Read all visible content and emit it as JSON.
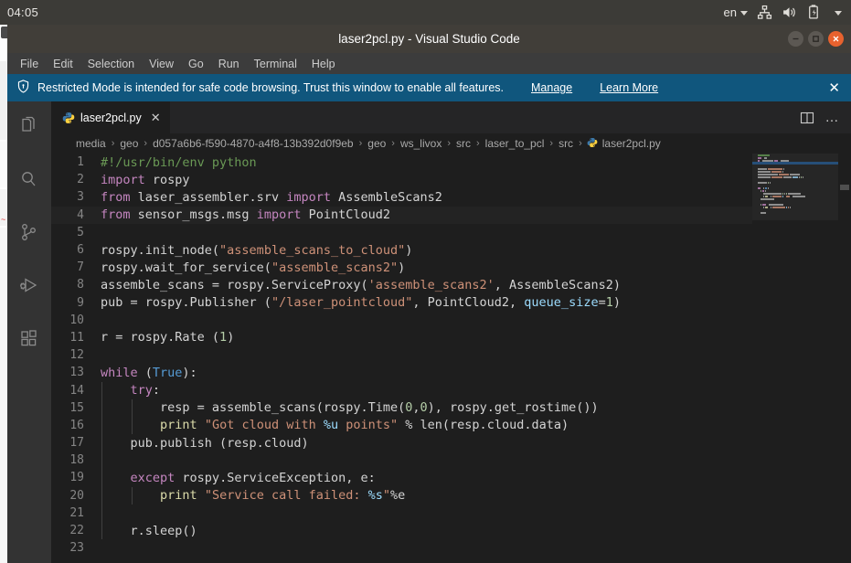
{
  "os_panel": {
    "clock": "04:05",
    "language_indicator": "en",
    "tray_icons": [
      "network-icon",
      "volume-icon",
      "battery-icon",
      "system-menu-caret-icon"
    ]
  },
  "window": {
    "title": "laser2pcl.py - Visual Studio Code",
    "controls": {
      "minimize_label": "–",
      "maximize_label": "□",
      "close_label": "✕"
    }
  },
  "menubar": {
    "items": [
      {
        "label": "File"
      },
      {
        "label": "Edit"
      },
      {
        "label": "Selection"
      },
      {
        "label": "View"
      },
      {
        "label": "Go"
      },
      {
        "label": "Run"
      },
      {
        "label": "Terminal"
      },
      {
        "label": "Help"
      }
    ]
  },
  "banner": {
    "icon": "shield-icon",
    "message": "Restricted Mode is intended for safe code browsing. Trust this window to enable all features.",
    "manage_label": "Manage",
    "learn_more_label": "Learn More",
    "close_label": "✕",
    "background": "#10567d"
  },
  "activity_bar": {
    "items": [
      {
        "name": "explorer-icon",
        "label": "Explorer"
      },
      {
        "name": "search-icon",
        "label": "Search"
      },
      {
        "name": "source-control-icon",
        "label": "Source Control"
      },
      {
        "name": "run-and-debug-icon",
        "label": "Run and Debug"
      },
      {
        "name": "extensions-icon",
        "label": "Extensions"
      }
    ]
  },
  "tabs": {
    "active": {
      "label": "laser2pcl.py",
      "icon": "python-file-icon",
      "close_label": "✕"
    },
    "actions": [
      {
        "name": "split-editor-icon",
        "label": "Split Editor"
      },
      {
        "name": "more-actions-icon",
        "label": "…"
      }
    ]
  },
  "breadcrumbs": {
    "separator": "›",
    "items": [
      "media",
      "geo",
      "d057a6b6-f590-4870-a4f8-13b392d0f9eb",
      "geo",
      "ws_livox",
      "src",
      "laser_to_pcl",
      "src"
    ],
    "file": "laser2pcl.py",
    "file_icon": "python-file-icon"
  },
  "editor": {
    "language": "python",
    "theme": "Dark+",
    "first_line": 1,
    "last_line": 23,
    "highlighted_line": 4,
    "colors": {
      "background": "#1e1e1e",
      "foreground": "#d4d4d4",
      "line_number": "#858585",
      "comment": "#6a9955",
      "keyword": "#c586c0",
      "builtin_keyword": "#569cd6",
      "string": "#ce9178",
      "function": "#dcdcaa",
      "variable": "#9cdcfe",
      "number": "#b5cea8",
      "class": "#4ec9b0",
      "current_line_bg": "#232323",
      "indent_guide": "#404040"
    },
    "lines": [
      {
        "n": 1,
        "indent": 0,
        "tokens": [
          {
            "t": "#!/usr/bin/env python",
            "c": "t-cmt"
          }
        ]
      },
      {
        "n": 2,
        "indent": 0,
        "tokens": [
          {
            "t": "import",
            "c": "t-kw"
          },
          {
            "t": " rospy",
            "c": "t-pl"
          }
        ]
      },
      {
        "n": 3,
        "indent": 0,
        "tokens": [
          {
            "t": "from",
            "c": "t-kw"
          },
          {
            "t": " laser_assembler.srv ",
            "c": "t-pl"
          },
          {
            "t": "import",
            "c": "t-kw"
          },
          {
            "t": " AssembleScans2",
            "c": "t-pl"
          }
        ]
      },
      {
        "n": 4,
        "indent": 0,
        "tokens": [
          {
            "t": "from",
            "c": "t-kw"
          },
          {
            "t": " sensor_msgs.msg ",
            "c": "t-pl"
          },
          {
            "t": "import",
            "c": "t-kw"
          },
          {
            "t": " PointCloud2",
            "c": "t-pl"
          }
        ]
      },
      {
        "n": 5,
        "indent": 0,
        "tokens": []
      },
      {
        "n": 6,
        "indent": 0,
        "tokens": [
          {
            "t": "rospy.init_node(",
            "c": "t-pl"
          },
          {
            "t": "\"assemble_scans_to_cloud\"",
            "c": "t-str"
          },
          {
            "t": ")",
            "c": "t-pl"
          }
        ]
      },
      {
        "n": 7,
        "indent": 0,
        "tokens": [
          {
            "t": "rospy.wait_for_service(",
            "c": "t-pl"
          },
          {
            "t": "\"assemble_scans2\"",
            "c": "t-str"
          },
          {
            "t": ")",
            "c": "t-pl"
          }
        ]
      },
      {
        "n": 8,
        "indent": 0,
        "tokens": [
          {
            "t": "assemble_scans = rospy.ServiceProxy(",
            "c": "t-pl"
          },
          {
            "t": "'assemble_scans2'",
            "c": "t-str"
          },
          {
            "t": ", AssembleScans2)",
            "c": "t-pl"
          }
        ]
      },
      {
        "n": 9,
        "indent": 0,
        "tokens": [
          {
            "t": "pub = rospy.Publisher (",
            "c": "t-pl"
          },
          {
            "t": "\"/laser_pointcloud\"",
            "c": "t-str"
          },
          {
            "t": ", PointCloud2, ",
            "c": "t-pl"
          },
          {
            "t": "queue_size",
            "c": "t-var"
          },
          {
            "t": "=",
            "c": "t-pl"
          },
          {
            "t": "1",
            "c": "t-num"
          },
          {
            "t": ")",
            "c": "t-pl"
          }
        ]
      },
      {
        "n": 10,
        "indent": 0,
        "tokens": []
      },
      {
        "n": 11,
        "indent": 0,
        "tokens": [
          {
            "t": "r = rospy.Rate (",
            "c": "t-pl"
          },
          {
            "t": "1",
            "c": "t-num"
          },
          {
            "t": ")",
            "c": "t-pl"
          }
        ]
      },
      {
        "n": 12,
        "indent": 0,
        "tokens": []
      },
      {
        "n": 13,
        "indent": 0,
        "tokens": [
          {
            "t": "while",
            "c": "t-kw"
          },
          {
            "t": " (",
            "c": "t-pl"
          },
          {
            "t": "True",
            "c": "t-bkw"
          },
          {
            "t": "):",
            "c": "t-pl"
          }
        ]
      },
      {
        "n": 14,
        "indent": 1,
        "tokens": [
          {
            "t": "    ",
            "c": "t-pl"
          },
          {
            "t": "try",
            "c": "t-kw"
          },
          {
            "t": ":",
            "c": "t-pl"
          }
        ]
      },
      {
        "n": 15,
        "indent": 2,
        "tokens": [
          {
            "t": "        resp = assemble_scans(rospy.Time(",
            "c": "t-pl"
          },
          {
            "t": "0",
            "c": "t-num"
          },
          {
            "t": ",",
            "c": "t-pl"
          },
          {
            "t": "0",
            "c": "t-num"
          },
          {
            "t": "), rospy.get_rostime())",
            "c": "t-pl"
          }
        ]
      },
      {
        "n": 16,
        "indent": 2,
        "tokens": [
          {
            "t": "        ",
            "c": "t-pl"
          },
          {
            "t": "print",
            "c": "t-fn"
          },
          {
            "t": " ",
            "c": "t-pl"
          },
          {
            "t": "\"Got cloud with ",
            "c": "t-str"
          },
          {
            "t": "%u",
            "c": "t-var"
          },
          {
            "t": " points\"",
            "c": "t-str"
          },
          {
            "t": " % len(resp.cloud.data)",
            "c": "t-pl"
          }
        ]
      },
      {
        "n": 17,
        "indent": 1,
        "tokens": [
          {
            "t": "    pub.publish (resp.cloud)",
            "c": "t-pl"
          }
        ]
      },
      {
        "n": 18,
        "indent": 1,
        "tokens": []
      },
      {
        "n": 19,
        "indent": 1,
        "tokens": [
          {
            "t": "    ",
            "c": "t-pl"
          },
          {
            "t": "except",
            "c": "t-kw"
          },
          {
            "t": " rospy.ServiceException, e:",
            "c": "t-pl"
          }
        ]
      },
      {
        "n": 20,
        "indent": 2,
        "tokens": [
          {
            "t": "        ",
            "c": "t-pl"
          },
          {
            "t": "print",
            "c": "t-fn"
          },
          {
            "t": " ",
            "c": "t-pl"
          },
          {
            "t": "\"Service call failed: ",
            "c": "t-str"
          },
          {
            "t": "%s",
            "c": "t-var"
          },
          {
            "t": "\"",
            "c": "t-str"
          },
          {
            "t": "%e",
            "c": "t-pl"
          }
        ]
      },
      {
        "n": 21,
        "indent": 1,
        "tokens": []
      },
      {
        "n": 22,
        "indent": 1,
        "tokens": [
          {
            "t": "    r.sleep()",
            "c": "t-pl"
          }
        ]
      },
      {
        "n": 23,
        "indent": 0,
        "tokens": []
      }
    ]
  },
  "minimap": {
    "visible": true,
    "slider_visible": true
  },
  "scrollbar": {
    "vertical_visible": true
  }
}
